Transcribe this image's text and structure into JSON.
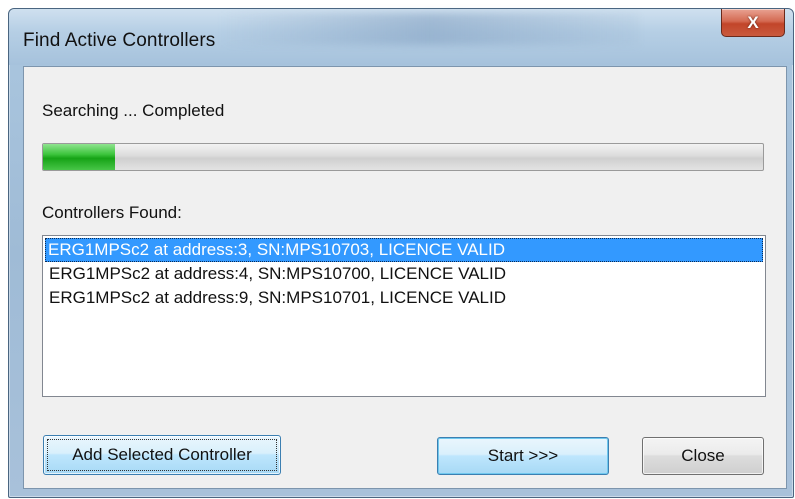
{
  "window": {
    "title": "Find Active Controllers",
    "close_glyph": "X",
    "close_icon": "close-icon"
  },
  "status": {
    "text": "Searching ... Completed",
    "progress_fraction": 0.1
  },
  "controllers": {
    "label": "Controllers Found:",
    "items": [
      "ERG1MPSc2 at address:3, SN:MPS10703, LICENCE VALID",
      "ERG1MPSc2 at address:4, SN:MPS10700, LICENCE VALID",
      "ERG1MPSc2 at address:9, SN:MPS10701, LICENCE VALID"
    ],
    "selected_index": 0
  },
  "buttons": {
    "add_selected": "Add Selected Controller",
    "start": "Start >>>",
    "close": "Close"
  },
  "colors": {
    "selection": "#3399ff",
    "progress": "#16a316",
    "close_button": "#c2452a"
  }
}
